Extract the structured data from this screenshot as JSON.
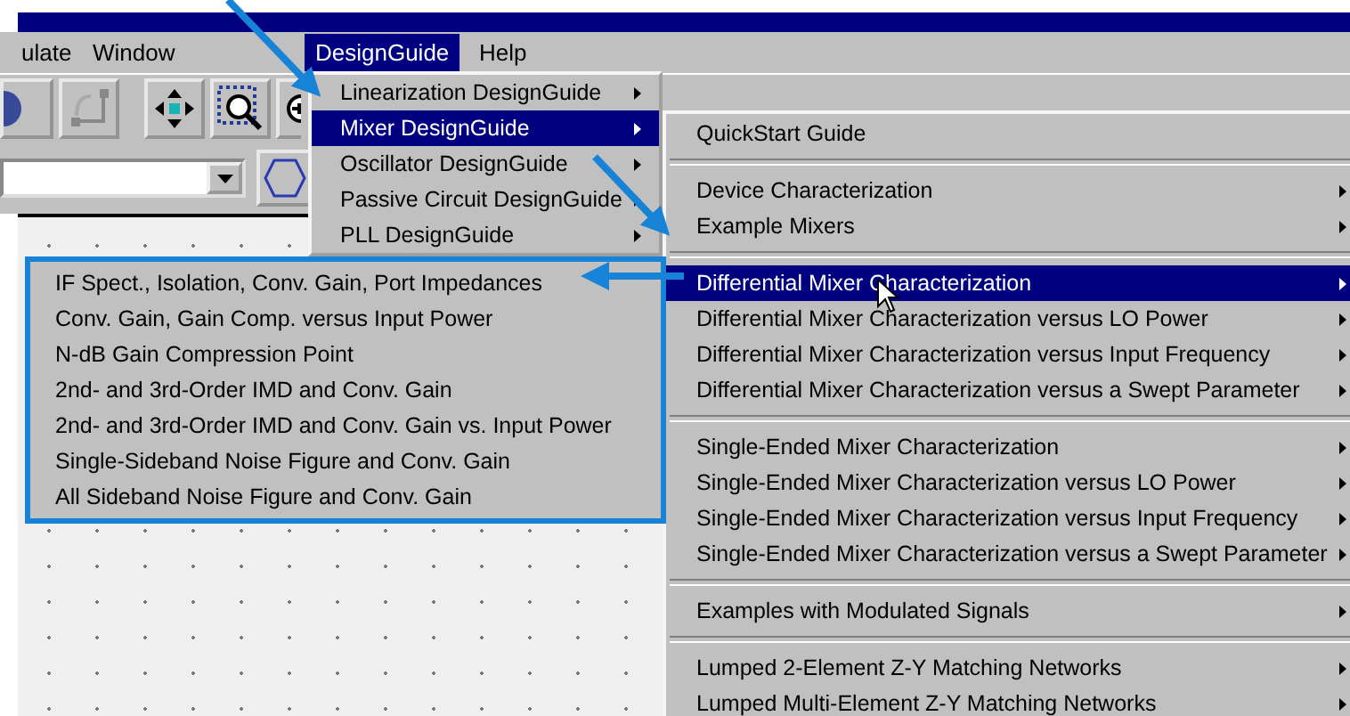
{
  "menu_bar": [
    {
      "label": "ulate",
      "selected": false
    },
    {
      "label": "Window",
      "selected": false
    },
    {
      "label": "DesignGuide",
      "selected": true
    },
    {
      "label": "Help",
      "selected": false
    }
  ],
  "designguide_menu": [
    {
      "label": "Linearization DesignGuide",
      "selected": false,
      "submenu": true
    },
    {
      "label": "Mixer DesignGuide",
      "selected": true,
      "submenu": true
    },
    {
      "label": "Oscillator DesignGuide",
      "selected": false,
      "submenu": true
    },
    {
      "label": "Passive Circuit DesignGuide",
      "selected": false,
      "submenu": true
    },
    {
      "label": "PLL DesignGuide",
      "selected": false,
      "submenu": true
    }
  ],
  "mixer_menu_groups": [
    {
      "items": [
        {
          "label": "QuickStart Guide",
          "selected": false,
          "submenu": false
        }
      ]
    },
    {
      "items": [
        {
          "label": "Device Characterization",
          "selected": false,
          "submenu": true
        },
        {
          "label": "Example Mixers",
          "selected": false,
          "submenu": true
        }
      ]
    },
    {
      "items": [
        {
          "label": "Differential Mixer Characterization",
          "selected": true,
          "submenu": true
        },
        {
          "label": "Differential Mixer Characterization versus LO Power",
          "selected": false,
          "submenu": true
        },
        {
          "label": "Differential Mixer Characterization versus Input Frequency",
          "selected": false,
          "submenu": true
        },
        {
          "label": "Differential Mixer Characterization versus a Swept Parameter",
          "selected": false,
          "submenu": true
        }
      ]
    },
    {
      "items": [
        {
          "label": "Single-Ended Mixer Characterization",
          "selected": false,
          "submenu": true
        },
        {
          "label": "Single-Ended Mixer Characterization versus LO Power",
          "selected": false,
          "submenu": true
        },
        {
          "label": "Single-Ended Mixer Characterization versus Input Frequency",
          "selected": false,
          "submenu": true
        },
        {
          "label": "Single-Ended Mixer Characterization versus a Swept Parameter",
          "selected": false,
          "submenu": true
        }
      ]
    },
    {
      "items": [
        {
          "label": "Examples with Modulated Signals",
          "selected": false,
          "submenu": true
        }
      ]
    },
    {
      "items": [
        {
          "label": "Lumped 2-Element Z-Y Matching Networks",
          "selected": false,
          "submenu": true
        },
        {
          "label": "Lumped Multi-Element Z-Y Matching Networks",
          "selected": false,
          "submenu": true
        }
      ]
    }
  ],
  "differential_submenu": [
    "IF Spect., Isolation, Conv. Gain, Port Impedances",
    "Conv. Gain, Gain Comp. versus Input Power",
    "N-dB Gain Compression Point",
    "2nd- and 3rd-Order IMD and Conv. Gain",
    "2nd- and 3rd-Order IMD and Conv. Gain vs. Input Power",
    "Single-Sideband Noise Figure and Conv. Gain",
    "All Sideband Noise Figure and Conv. Gain"
  ]
}
